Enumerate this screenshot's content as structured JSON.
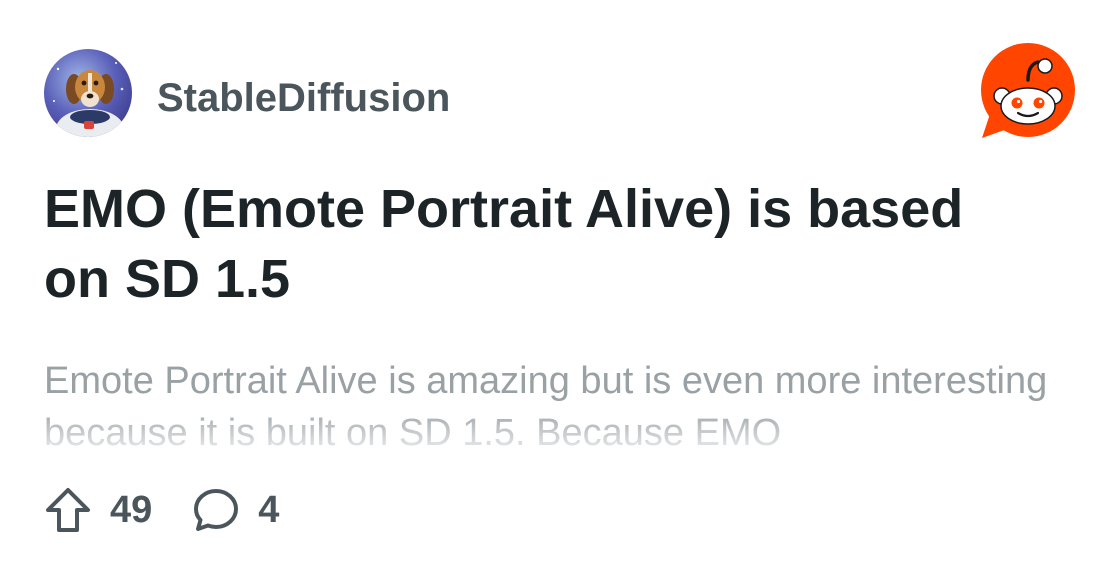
{
  "post": {
    "subreddit": "StableDiffusion",
    "title": "EMO (Emote Portrait Alive) is based on SD 1.5",
    "body": "Emote Portrait Alive is amazing but is even more interesting because it is built on SD 1.5. Because EMO",
    "upvotes": "49",
    "comments": "4"
  },
  "icons": {
    "avatar": "astronaut-dog-avatar",
    "logo": "reddit-snoo-logo",
    "upvote": "upvote-arrow-icon",
    "comment": "comment-bubble-icon"
  },
  "colors": {
    "title": "#1c2428",
    "meta": "#4b565c",
    "body": "#9aa1a5",
    "brand": "#ff4500"
  }
}
